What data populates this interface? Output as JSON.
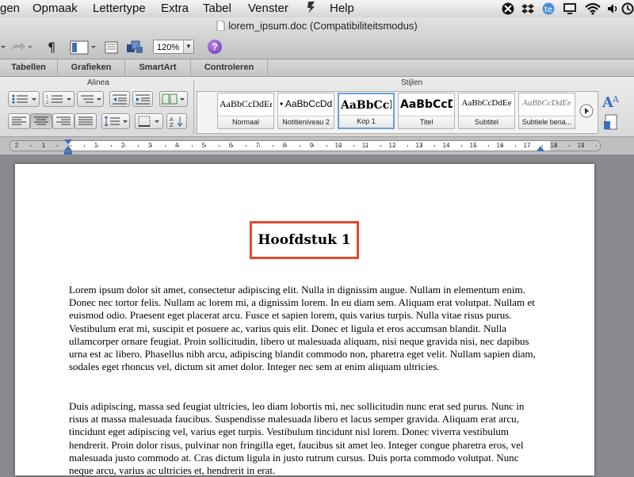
{
  "menubar": {
    "items": [
      "gen",
      "Opmaak",
      "Lettertype",
      "Extra",
      "Tabel",
      "Venster",
      "Help"
    ],
    "status_icons": [
      "xmarks-icon",
      "dropbox-icon",
      "text-expander-icon",
      "display-icon",
      "wifi-icon",
      "volume-icon",
      "time-machine-icon"
    ]
  },
  "window": {
    "title": "lorem_ipsum.doc (Compatibiliteitsmodus)"
  },
  "toolbar": {
    "zoom": "120%",
    "help_label": "?"
  },
  "tabs": [
    "Tabellen",
    "Grafieken",
    "SmartArt",
    "Controleren"
  ],
  "ribbon": {
    "group_alinea": "Alinea",
    "group_stijlen": "Stijlen",
    "styles": [
      {
        "preview": "AaBbCcDdEe",
        "name": "Normaal"
      },
      {
        "preview": "• AaBbCcDd",
        "name": "Notitieniveau 2"
      },
      {
        "preview": "AaBbCcDd",
        "name": "Kop 1"
      },
      {
        "preview": "AaBbCcDd",
        "name": "Titel"
      },
      {
        "preview": "AaBbCcDdEe",
        "name": "Subtitel"
      },
      {
        "preview": "AaBbCcDdEe",
        "name": "Subtiele bena..."
      }
    ]
  },
  "ruler": {
    "numbers": [
      "2",
      "1",
      "1",
      "2",
      "3",
      "4",
      "5",
      "6",
      "7",
      "8",
      "9",
      "10",
      "11",
      "12",
      "13",
      "14",
      "15",
      "16",
      "17",
      "18",
      "19"
    ]
  },
  "document": {
    "heading": "Hoofdstuk 1",
    "paragraphs": [
      "Lorem ipsum dolor sit amet, consectetur adipiscing elit. Nulla in dignissim augue. Nullam in elementum enim. Donec nec tortor felis. Nullam ac lorem mi, a dignissim lorem. In eu diam sem. Aliquam erat volutpat. Nullam et euismod odio. Praesent eget placerat arcu. Fusce et sapien lorem, quis varius turpis. Nulla vitae risus purus. Vestibulum erat mi, suscipit et posuere ac, varius quis elit. Donec et ligula et eros accumsan blandit. Nulla ullamcorper ornare feugiat. Proin sollicitudin, libero ut malesuada aliquam, nisi neque gravida nisi, nec dapibus urna est ac libero. Phasellus nibh arcu, adipiscing blandit commodo non, pharetra eget velit. Nullam sapien diam, sodales eget rhoncus vel, dictum sit amet dolor. Integer nec sem at enim aliquam ultricies.",
      "Duis adipiscing, massa sed feugiat ultricies, leo diam lobortis mi, nec sollicitudin nunc erat sed purus. Nunc in risus at massa malesuada faucibus. Suspendisse malesuada libero et lacus semper gravida. Aliquam erat arcu, tincidunt eget adipiscing vel, varius eget turpis. Vestibulum tincidunt nisl lorem. Donec viverra vestibulum hendrerit. Proin dolor risus, pulvinar non fringilla eget, faucibus sit amet leo. Integer congue pharetra eros, vel malesuada justo commodo at. Cras dictum ligula in justo rutrum cursus. Duis porta commodo volutpat. Nunc neque arcu, varius ac ultricies et, hendrerit in erat."
    ]
  }
}
